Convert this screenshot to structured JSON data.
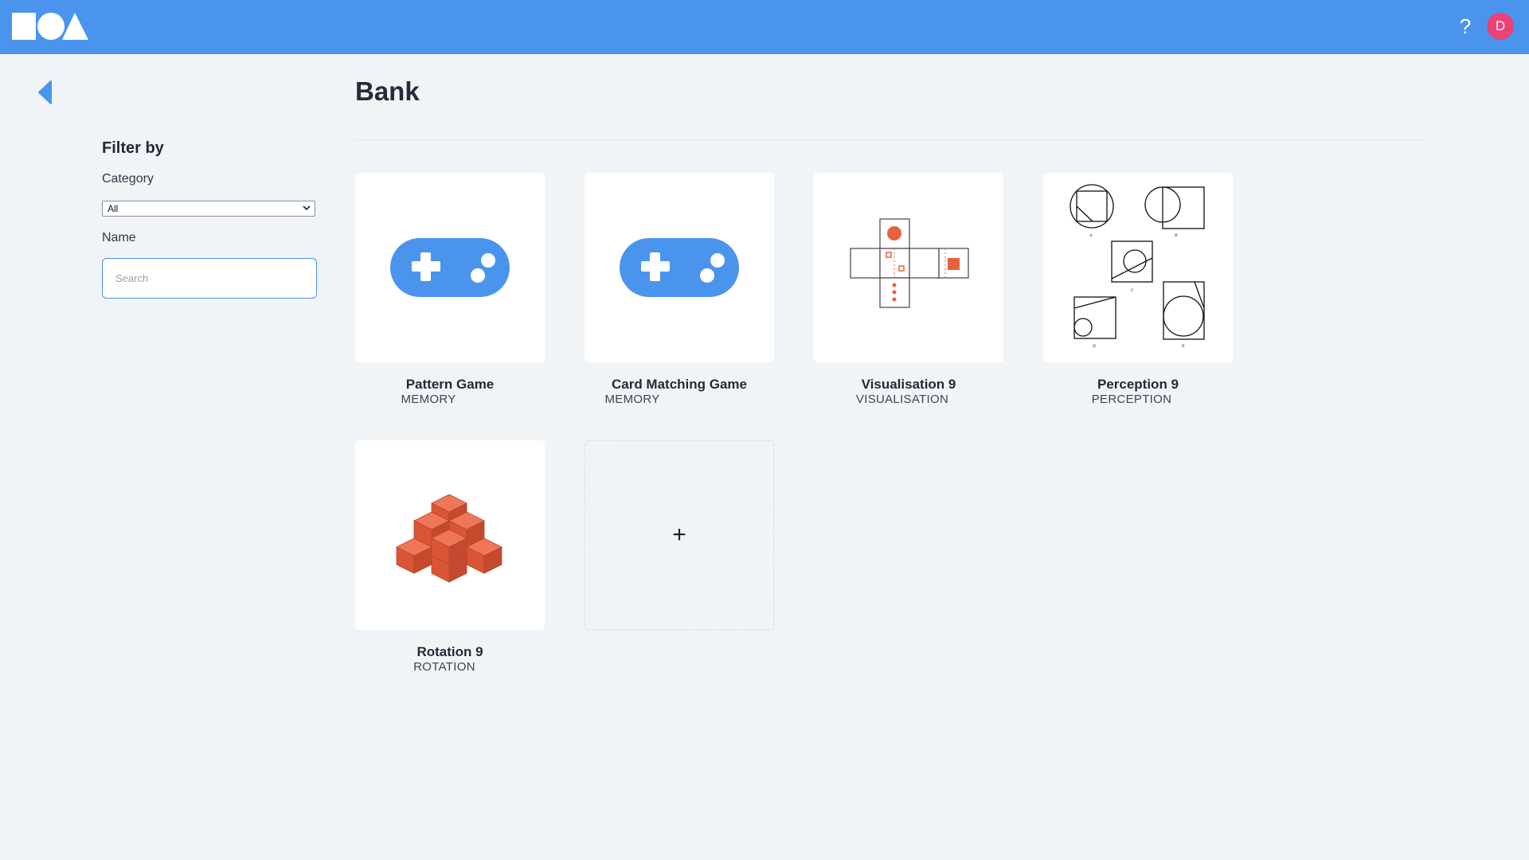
{
  "header": {
    "logo_name": "shapes-logo",
    "help_label": "?",
    "avatar_initial": "D"
  },
  "page": {
    "title": "Bank"
  },
  "filter": {
    "title": "Filter by",
    "category_label": "Category",
    "category_selected": "All",
    "name_label": "Name",
    "search_placeholder": "Search",
    "search_value": ""
  },
  "cards": [
    {
      "name": "Pattern Game",
      "category": "MEMORY",
      "icon": "gamepad-icon"
    },
    {
      "name": "Card Matching Game",
      "category": "MEMORY",
      "icon": "gamepad-icon"
    },
    {
      "name": "Visualisation 9",
      "category": "VISUALISATION",
      "icon": "cube-net-icon"
    },
    {
      "name": "Perception 9",
      "category": "PERCEPTION",
      "icon": "shapes-figure-icon"
    },
    {
      "name": "Rotation 9",
      "category": "ROTATION",
      "icon": "block-stack-icon"
    }
  ],
  "add_card": {
    "label": "+"
  },
  "colors": {
    "header_bg": "#4a94ee",
    "accent": "#4a94ee",
    "avatar": "#ec4277",
    "orange": "#e9603f",
    "page_bg": "#f1f4f7"
  }
}
